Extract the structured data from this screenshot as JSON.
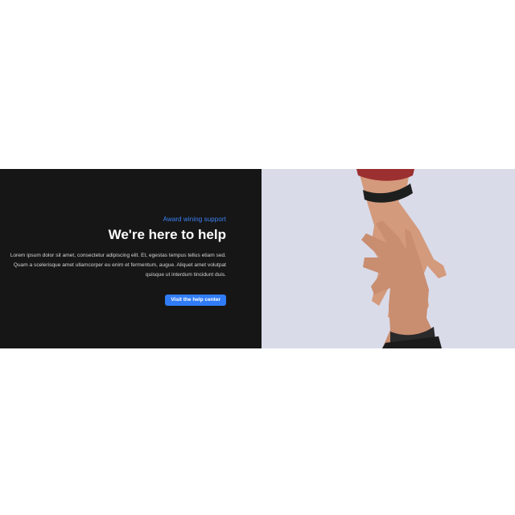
{
  "hero": {
    "eyebrow": "Award wining support",
    "title": "We're here to help",
    "body": "Lorem ipsum dolor sit amet, consectetur adipiscing elit. Et, egestas tempus tellus etiam sed. Quam a scelerisque amet ullamcorper eu enim et fermentum, augue. Aliquet amet volutpat quisque ut interdum tincidunt duis.",
    "cta_label": "Visit the help center"
  },
  "image": {
    "subject": "two hands reaching toward each other against pale sky",
    "icon": "hands-photo"
  },
  "colors": {
    "panel_bg": "#161616",
    "accent": "#2f7cf6",
    "eyebrow": "#3b82f6",
    "sky": "#d9dbe9",
    "skin": "#d79f82"
  }
}
